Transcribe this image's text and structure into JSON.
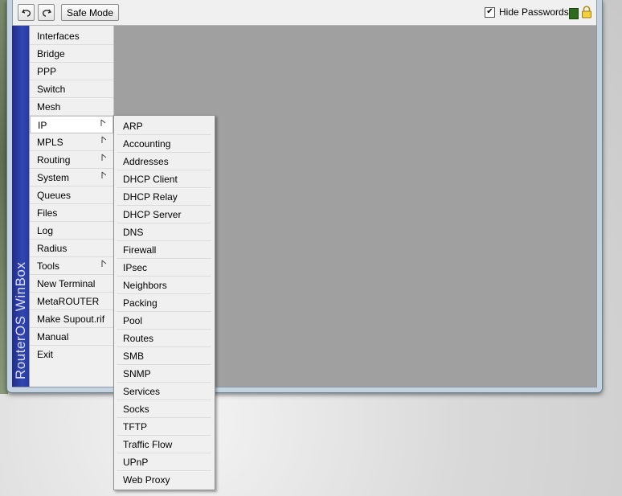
{
  "toolbar": {
    "undo_icon": "undo-icon",
    "redo_icon": "redo-icon",
    "safe_mode_label": "Safe Mode",
    "hide_passwords_label": "Hide Passwords",
    "hide_passwords_checked": true,
    "checkmark": "✔",
    "status_color": "#2e6b1e"
  },
  "brand": {
    "text": "RouterOS WinBox"
  },
  "main_menu": {
    "items": [
      {
        "label": "Interfaces"
      },
      {
        "label": "Bridge"
      },
      {
        "label": "PPP"
      },
      {
        "label": "Switch"
      },
      {
        "label": "Mesh"
      },
      {
        "label": "IP",
        "submenu": true,
        "active": true
      },
      {
        "label": "MPLS",
        "submenu": true
      },
      {
        "label": "Routing",
        "submenu": true
      },
      {
        "label": "System",
        "submenu": true
      },
      {
        "label": "Queues"
      },
      {
        "label": "Files"
      },
      {
        "label": "Log"
      },
      {
        "label": "Radius"
      },
      {
        "label": "Tools",
        "submenu": true
      },
      {
        "label": "New Terminal"
      },
      {
        "label": "MetaROUTER"
      },
      {
        "label": "Make Supout.rif"
      },
      {
        "label": "Manual"
      },
      {
        "label": "Exit"
      }
    ]
  },
  "ip_submenu": {
    "items": [
      "ARP",
      "Accounting",
      "Addresses",
      "DHCP Client",
      "DHCP Relay",
      "DHCP Server",
      "DNS",
      "Firewall",
      "IPsec",
      "Neighbors",
      "Packing",
      "Pool",
      "Routes",
      "SMB",
      "SNMP",
      "Services",
      "Socks",
      "TFTP",
      "Traffic Flow",
      "UPnP",
      "Web Proxy"
    ]
  },
  "colors": {
    "workspace": "#a0a0a0",
    "brand_bar": "#2a3aa0"
  }
}
